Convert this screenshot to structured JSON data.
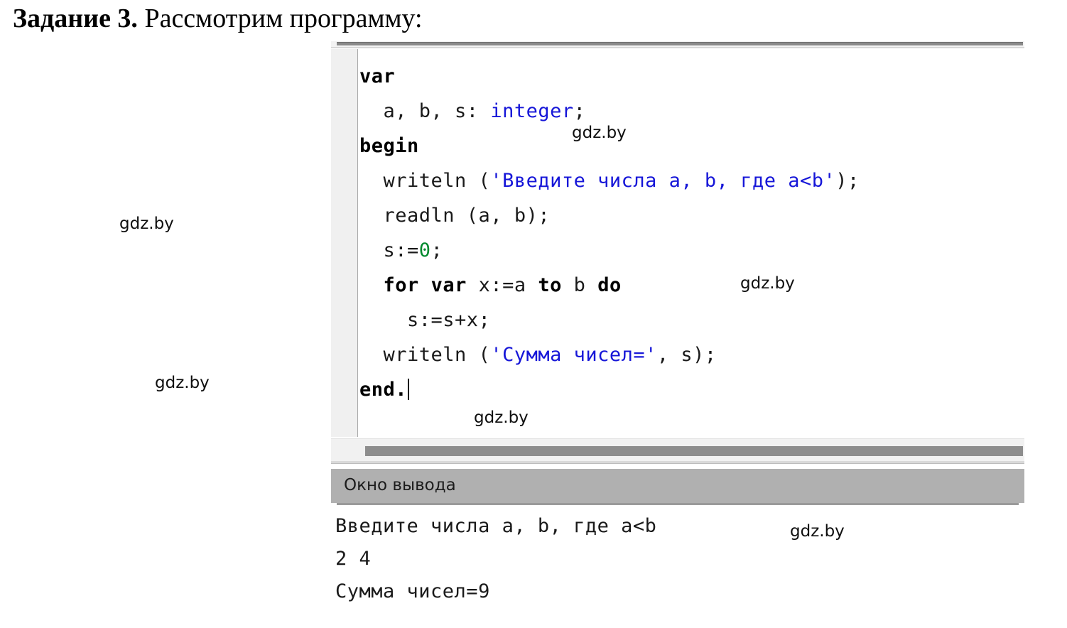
{
  "heading": {
    "task_label": "Задание 3.",
    "task_text": " Рассмотрим программу:"
  },
  "editor": {
    "language": "Pascal",
    "caret_line": "end.",
    "colors": {
      "keyword": "#000000",
      "string": "#1616d8",
      "type": "#1616d8",
      "number": "#008a2e",
      "plain": "#1a1a1a",
      "background": "#ffffff",
      "gutter": "#f0f0f0",
      "titlebar": "#b0b0b0"
    },
    "lines": [
      {
        "indent": "",
        "tokens": [
          {
            "t": "var",
            "c": "kw"
          }
        ]
      },
      {
        "indent": "  ",
        "tokens": [
          {
            "t": "a, b, s: ",
            "c": "pl"
          },
          {
            "t": "integer",
            "c": "type"
          },
          {
            "t": ";",
            "c": "pl"
          }
        ]
      },
      {
        "indent": "",
        "tokens": [
          {
            "t": "begin",
            "c": "kw"
          }
        ]
      },
      {
        "indent": "  ",
        "tokens": [
          {
            "t": "writeln (",
            "c": "pl"
          },
          {
            "t": "'Введите числа a, b, где a<b'",
            "c": "str"
          },
          {
            "t": ");",
            "c": "pl"
          }
        ]
      },
      {
        "indent": "  ",
        "tokens": [
          {
            "t": "readln (a, b);",
            "c": "pl"
          }
        ]
      },
      {
        "indent": "  ",
        "tokens": [
          {
            "t": "s:=",
            "c": "pl"
          },
          {
            "t": "0",
            "c": "num"
          },
          {
            "t": ";",
            "c": "pl"
          }
        ]
      },
      {
        "indent": "  ",
        "tokens": [
          {
            "t": "for",
            "c": "kw"
          },
          {
            "t": " ",
            "c": "pl"
          },
          {
            "t": "var",
            "c": "kw"
          },
          {
            "t": " x:=a ",
            "c": "pl"
          },
          {
            "t": "to",
            "c": "kw"
          },
          {
            "t": " b ",
            "c": "pl"
          },
          {
            "t": "do",
            "c": "kw"
          }
        ]
      },
      {
        "indent": "    ",
        "tokens": [
          {
            "t": "s:=s+x;",
            "c": "pl"
          }
        ]
      },
      {
        "indent": "  ",
        "tokens": [
          {
            "t": "writeln (",
            "c": "pl"
          },
          {
            "t": "'Сумма чисел='",
            "c": "str"
          },
          {
            "t": ", s);",
            "c": "pl"
          }
        ]
      },
      {
        "indent": "",
        "tokens": [
          {
            "t": "end.",
            "c": "kw"
          }
        ],
        "caret": true
      }
    ]
  },
  "output_window": {
    "title": "Окно вывода",
    "lines": [
      "Введите числа a, b, где a<b",
      "2 4",
      "Сумма чисел=9"
    ]
  },
  "watermarks": [
    "gdz.by",
    "gdz.by",
    "gdz.by",
    "gdz.by",
    "gdz.by",
    "gdz.by"
  ]
}
